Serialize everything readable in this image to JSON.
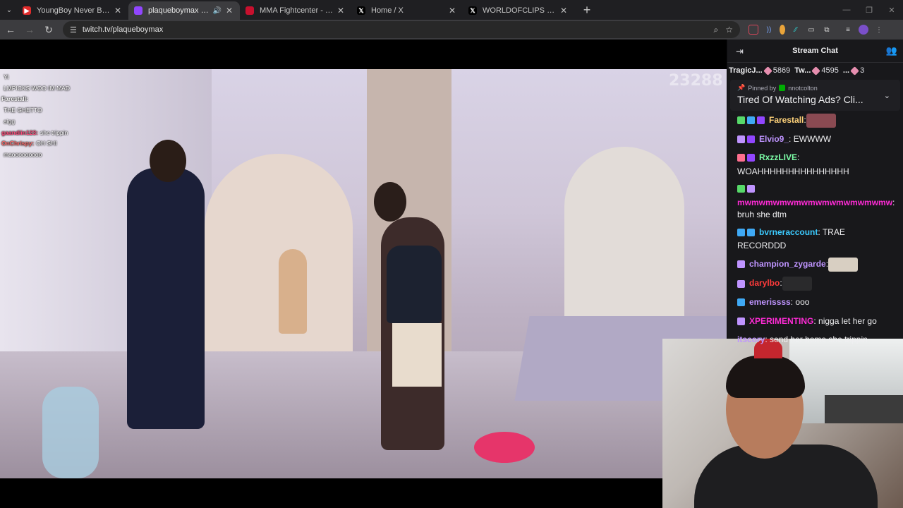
{
  "browser": {
    "tabs": [
      {
        "title": "YoungBoy Never Broke Again -",
        "favicon_color": "#e02b2b",
        "favicon_glyph": "▶",
        "active": false,
        "audio": false
      },
      {
        "title": "plaqueboymax - Twitch",
        "favicon_color": "#9146ff",
        "favicon_glyph": "",
        "active": true,
        "audio": true
      },
      {
        "title": "MMA Fightcenter - ESPN",
        "favicon_color": "#c8102e",
        "favicon_glyph": "",
        "active": false,
        "audio": false
      },
      {
        "title": "Home / X",
        "favicon_color": "#000000",
        "favicon_glyph": "𝕏",
        "active": false,
        "audio": false
      },
      {
        "title": "WORLDOFCLIPS on X: \"Mrbeas",
        "favicon_color": "#000000",
        "favicon_glyph": "𝕏",
        "active": false,
        "audio": false
      }
    ],
    "url": "twitch.tv/plaqueboymax"
  },
  "stream": {
    "viewer_overlay_count": "23288"
  },
  "overlay_chat": [
    {
      "name": "",
      "name_color": "#5fd3ff",
      "text": "Yi"
    },
    {
      "name": "",
      "name_color": "#57d96a",
      "text": "LMPICKS WOO IM MAD"
    },
    {
      "name": "Farestall:",
      "name_color": "#ffffff",
      "text": ""
    },
    {
      "name": "",
      "name_color": "#ff4a4a",
      "text": "THE GHETTO"
    },
    {
      "name": "",
      "name_color": "#ff6fa8",
      "text": "aigg"
    },
    {
      "name": "gaandiin123:",
      "name_color": "#ff4a7a",
      "text": "she trippin"
    },
    {
      "name": "OnChrispy:",
      "name_color": "#ff6a6a",
      "text": "OH SHI"
    },
    {
      "name": "",
      "name_color": "#ff4a4a",
      "text": "maooooooooo"
    }
  ],
  "chat": {
    "title": "Stream Chat",
    "leaderboard": [
      {
        "name": "TragicJ...",
        "amount": "5869"
      },
      {
        "name": "Tw...",
        "amount": "4595"
      },
      {
        "name": "...",
        "amount": "3"
      }
    ],
    "pinned": {
      "label": "Pinned by",
      "by": "nnotcolton",
      "text": "Tired Of Watching Ads? Cli..."
    },
    "messages": [
      {
        "user": "Farestall",
        "color": "#ffd37a",
        "sep": ":",
        "text": "",
        "badges": [
          "#57d96a",
          "#3fa9f5",
          "#9146ff"
        ],
        "emote": "#8a4a52"
      },
      {
        "user": "Elvio9_",
        "color": "#bf94ff",
        "sep": ":",
        "text": " EWWWW",
        "badges": [
          "#bf94ff",
          "#9146ff"
        ],
        "emote": ""
      },
      {
        "user": "RxzzLIVE",
        "color": "#7dffa8",
        "sep": ":",
        "text": " WOAHHHHHHHHHHHHHHH",
        "badges": [
          "#ff6f8f",
          "#9146ff"
        ],
        "emote": ""
      },
      {
        "user": "mwmwmwmwmwmwmwmwmwmwmw",
        "color": "#ff2bd6",
        "sep": "",
        "text": ": bruh she dtm",
        "badges": [
          "#57d96a",
          "#bf94ff"
        ],
        "emote": ""
      },
      {
        "user": "bvrneraccount",
        "color": "#3ccbff",
        "sep": ":",
        "text": " TRAE RECORDDD",
        "badges": [
          "#3fa9f5",
          "#3fa9f5"
        ],
        "emote": ""
      },
      {
        "user": "champion_zygarde",
        "color": "#bf94ff",
        "sep": ":",
        "text": "",
        "badges": [
          "#bf94ff"
        ],
        "emote": "#d8cfc2"
      },
      {
        "user": "darylbo",
        "color": "#ff3b3b",
        "sep": ":",
        "text": "",
        "badges": [
          "#bf94ff"
        ],
        "emote": "#2a2a2c"
      },
      {
        "user": "emerissss",
        "color": "#bf94ff",
        "sep": ":",
        "text": " ooo",
        "badges": [
          "#3fa9f5"
        ],
        "emote": ""
      },
      {
        "user": "XPERIMENTING",
        "color": "#ff2bd6",
        "sep": ":",
        "text": " nigga let her go",
        "badges": [
          "#bf94ff"
        ],
        "emote": ""
      },
      {
        "user": "itscory",
        "color": "#bf94ff",
        "sep": ":",
        "text": " send her home she trippin",
        "badges": [],
        "emote": ""
      }
    ]
  }
}
